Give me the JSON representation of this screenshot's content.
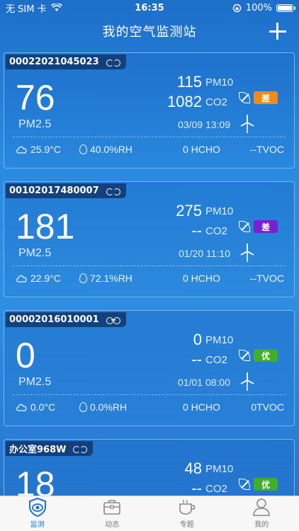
{
  "status_bar": {
    "carrier": "无 SIM 卡",
    "time": "16:35",
    "battery": "100%"
  },
  "nav": {
    "title": "我的空气监测站",
    "add_icon": "plus-icon"
  },
  "devices": [
    {
      "name": "00022021045023",
      "link_icon": "link-broken-icon",
      "pm25": "76",
      "pm25_label": "PM2.5",
      "pm10": "115",
      "pm10_label": "PM10",
      "co2": "1082",
      "co2_label": "CO2",
      "quality": "差",
      "quality_color": "#f08a1c",
      "time": "03/09 13:09",
      "temperature": "25.9°C",
      "humidity": "40.0%RH",
      "hcho": "0 HCHO",
      "tvoc": "--TVOC"
    },
    {
      "name": "00102017480007",
      "link_icon": "link-broken-icon",
      "pm25": "181",
      "pm25_label": "PM2.5",
      "pm10": "275",
      "pm10_label": "PM10",
      "co2": "--",
      "co2_label": "CO2",
      "quality": "差",
      "quality_color": "#7a1fd8",
      "time": "01/20 11:10",
      "temperature": "22.9°C",
      "humidity": "72.1%RH",
      "hcho": "0 HCHO",
      "tvoc": "--TVOC"
    },
    {
      "name": "00002016010001",
      "link_icon": "link-connected-icon",
      "pm25": "0",
      "pm25_label": "PM2.5",
      "pm10": "0",
      "pm10_label": "PM10",
      "co2": "--",
      "co2_label": "CO2",
      "quality": "优",
      "quality_color": "#3fae2a",
      "time": "01/01 08:00",
      "temperature": "0.0°C",
      "humidity": "0.0%RH",
      "hcho": "0 HCHO",
      "tvoc": "0TVOC"
    },
    {
      "name": "办公室968W",
      "link_icon": "link-broken-icon",
      "pm25": "18",
      "pm25_label": "PM2.5",
      "pm10": "48",
      "pm10_label": "PM10",
      "co2": "--",
      "co2_label": "CO2",
      "quality": "优",
      "quality_color": "#3fae2a",
      "time": "",
      "temperature": "",
      "humidity": "",
      "hcho": "",
      "tvoc": ""
    }
  ],
  "tabs": [
    {
      "label": "监测",
      "icon": "eye-shield-icon",
      "active": true
    },
    {
      "label": "动态",
      "icon": "briefcase-icon",
      "active": false
    },
    {
      "label": "专题",
      "icon": "cup-icon",
      "active": false
    },
    {
      "label": "我的",
      "icon": "person-icon",
      "active": false
    }
  ],
  "colors": {
    "accent": "#1a75d2",
    "tab_inactive": "#777777"
  }
}
